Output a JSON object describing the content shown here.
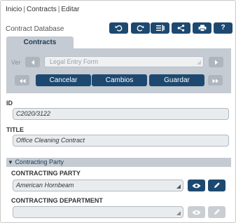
{
  "breadcrumb": {
    "items": [
      "Inicio",
      "Contracts",
      "Editar"
    ]
  },
  "database": {
    "title": "Contract Database"
  },
  "toolbar": {
    "icons": [
      "undo-icon",
      "redo-icon",
      "list-settings-icon",
      "share-icon",
      "print-icon",
      "help-icon"
    ],
    "help_label": "?"
  },
  "tabs": [
    {
      "label": "Contracts",
      "active": true
    }
  ],
  "view": {
    "label": "Ver",
    "placeholder": "Legal Entry Form"
  },
  "actions": {
    "cancel": "Cancelar",
    "changes": "Cambios",
    "save": "Guardar"
  },
  "fields": {
    "id": {
      "label": "ID",
      "value": "C2020/3122"
    },
    "title": {
      "label": "TITLE",
      "value": "Office Cleaning Contract"
    }
  },
  "section": {
    "label": "Contracting Party",
    "expanded": true,
    "party": {
      "label": "CONTRACTING PARTY",
      "value": "American Hornbeam"
    },
    "department": {
      "label": "CONTRACTING DEPARTMENT",
      "value": ""
    }
  },
  "colors": {
    "primary": "#1d4970",
    "panel": "#c4cbd2",
    "field_bg": "#e9ecef",
    "disabled": "#aeb5bc"
  }
}
